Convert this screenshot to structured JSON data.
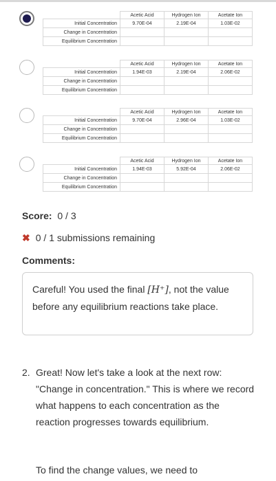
{
  "options": [
    {
      "selected": true,
      "headers": [
        "Acetic Acid",
        "Hydrogen Ion",
        "Acetate Ion"
      ],
      "initial": [
        "9.70E-04",
        "2.19E-04",
        "1.03E-02"
      ]
    },
    {
      "selected": false,
      "headers": [
        "Acetic Acid",
        "Hydrogen Ion",
        "Acetate Ion"
      ],
      "initial": [
        "1.94E-03",
        "2.19E-04",
        "2.06E-02"
      ]
    },
    {
      "selected": false,
      "headers": [
        "Acetic Acid",
        "Hydrogen Ion",
        "Acetate Ion"
      ],
      "initial": [
        "9.70E-04",
        "2.96E-04",
        "1.03E-02"
      ]
    },
    {
      "selected": false,
      "headers": [
        "Acetic Acid",
        "Hydrogen Ion",
        "Acetate Ion"
      ],
      "initial": [
        "1.94E-03",
        "5.92E-04",
        "2.06E-02"
      ]
    }
  ],
  "row_labels": {
    "initial": "Initial Concentration",
    "change": "Change in Concentration",
    "equilibrium": "Equilibrium Concentration"
  },
  "score": {
    "label": "Score:",
    "value": "0 / 3"
  },
  "submissions": {
    "text": "0 / 1 submissions remaining"
  },
  "comments": {
    "heading": "Comments:",
    "text_before": "Careful! You used the final ",
    "math": "[H⁺]",
    "text_after": ", not the value before any equilibrium reactions take place."
  },
  "step": {
    "number": "2.",
    "text": "Great! Now let's take a look at the next row: \"Change in concentration.\" This is where we record what happens to each concentration as the reaction progresses towards equilibrium.",
    "next": "To find the change values, we need to"
  }
}
